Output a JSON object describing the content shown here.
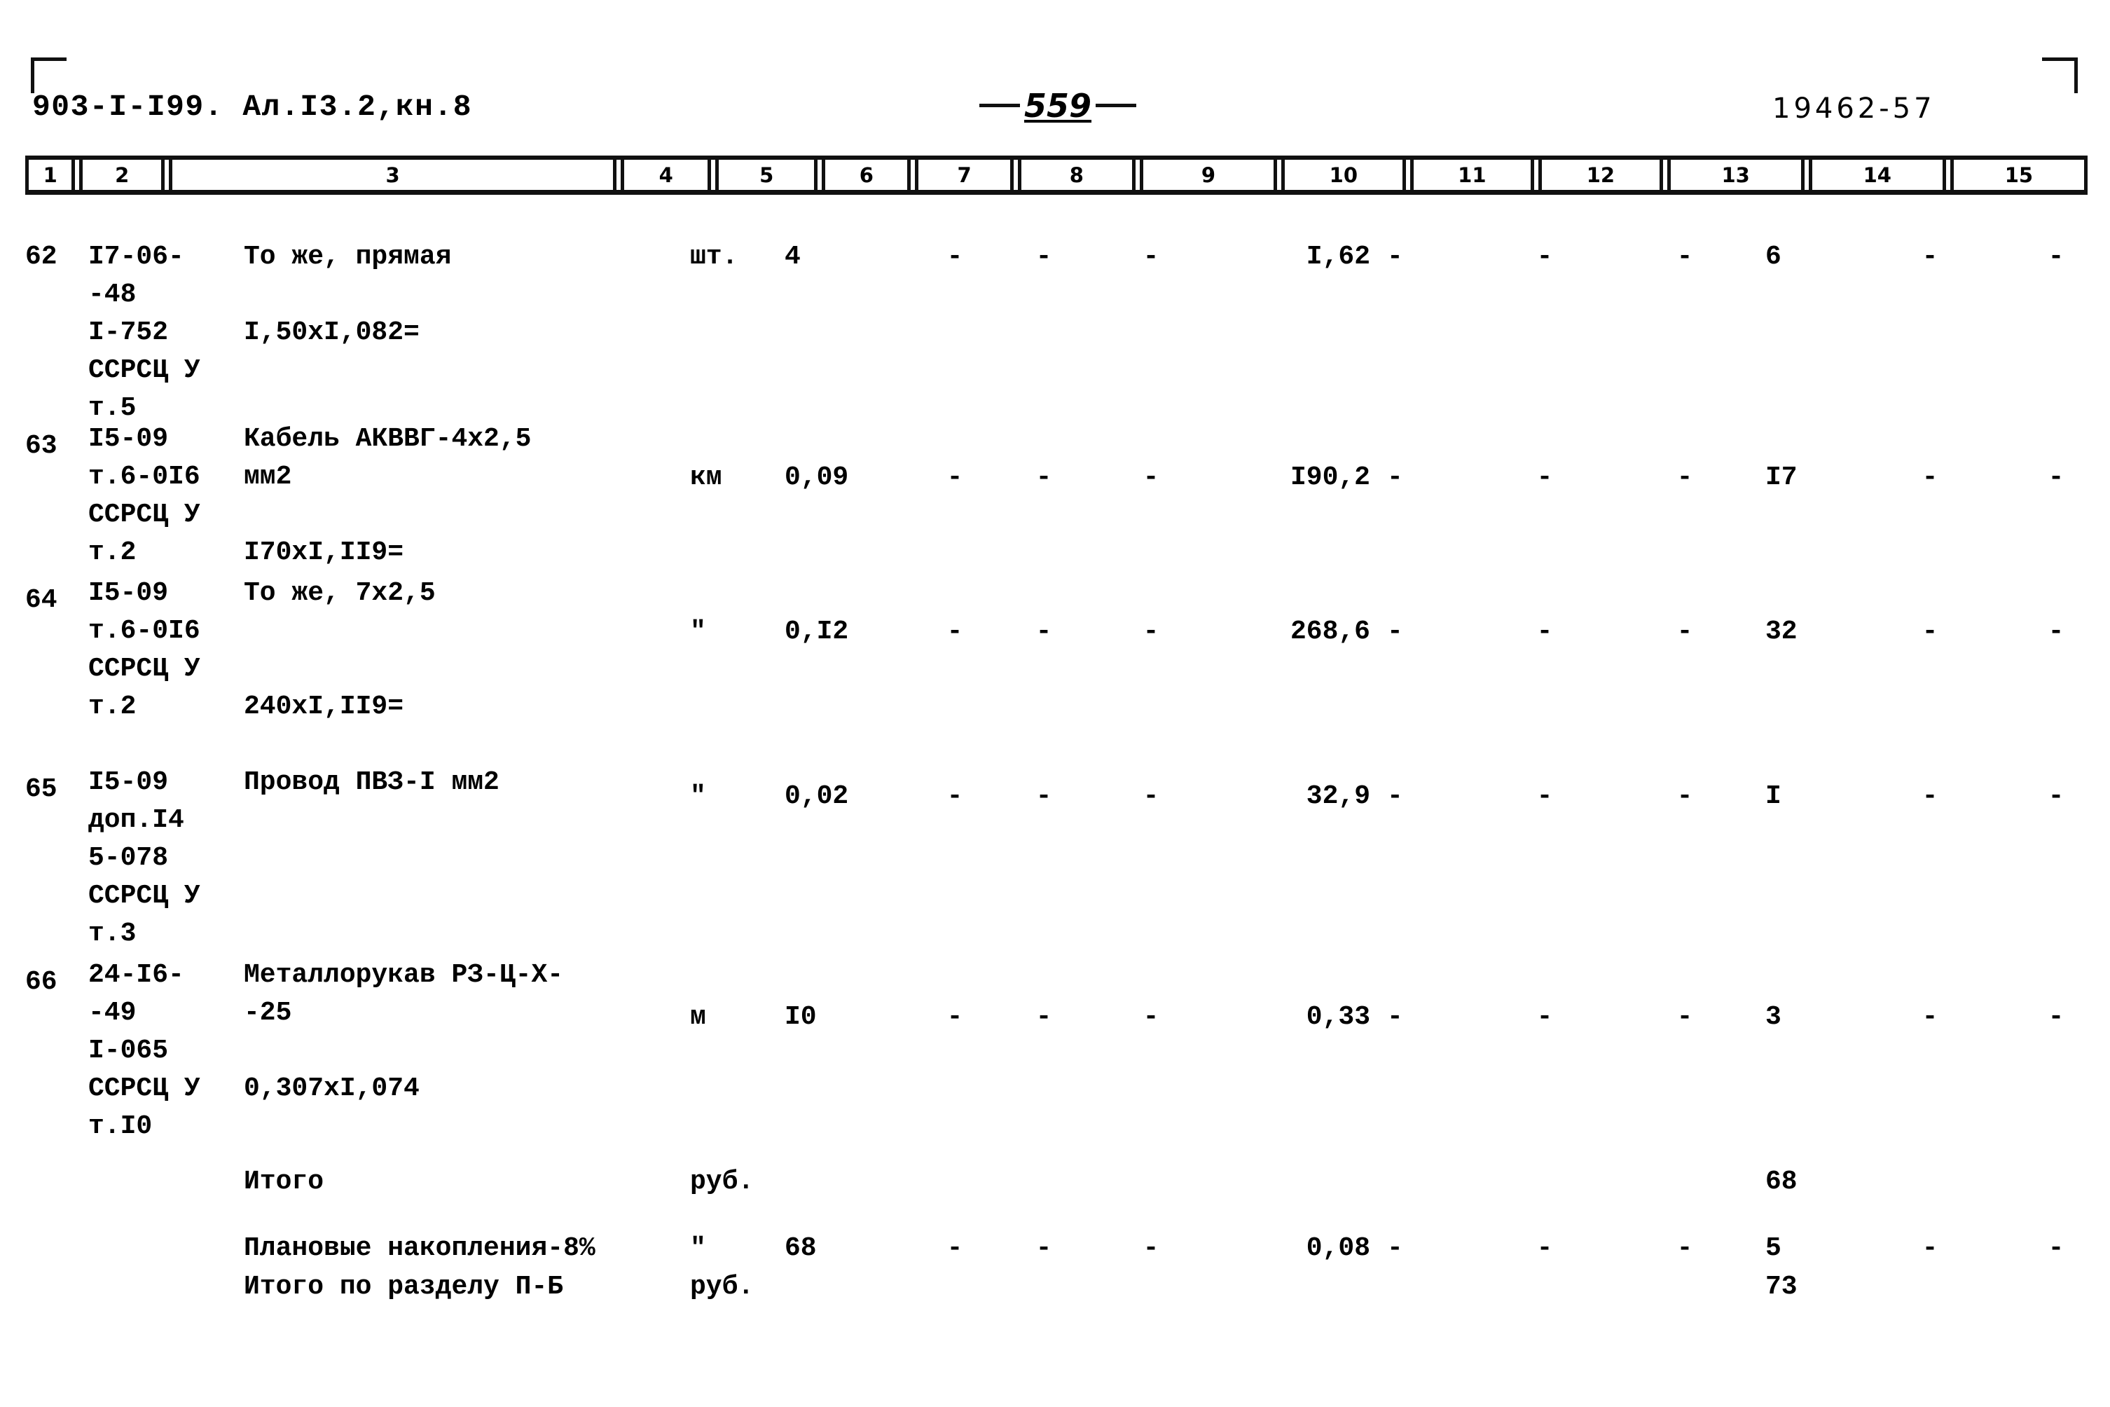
{
  "page": {
    "header_left": "903-I-I99. Ал.I3.2,кн.8",
    "page_number": "559",
    "header_right": "19462-57"
  },
  "table": {
    "column_numbers": [
      "1",
      "2",
      "3",
      "4",
      "5",
      "6",
      "7",
      "8",
      "9",
      "10",
      "11",
      "12",
      "13",
      "14",
      "15"
    ],
    "rows": [
      {
        "num": "62",
        "code": "I7-06-\n -48\nI-752\nССРСЦ У\nт.5",
        "desc": "То же, прямая\n\nI,50xI,082=",
        "unit": "шт.",
        "c5": "4",
        "c6": "-",
        "c7": "-",
        "c8": "-",
        "c9": "I,62",
        "c10": "-",
        "c11": "-",
        "c12": "-",
        "c13": "6",
        "c14": "-",
        "c15": "-"
      },
      {
        "num": "63",
        "code": "I5-09\nт.6-0I6\nССРСЦ У\nт.2",
        "desc": "Кабель АКВВГ-4x2,5\nмм2\n\nI70xI,II9=",
        "unit": "км",
        "c5": "0,09",
        "c6": "-",
        "c7": "-",
        "c8": "-",
        "c9": "I90,2",
        "c10": "-",
        "c11": "-",
        "c12": "-",
        "c13": "I7",
        "c14": "-",
        "c15": "-"
      },
      {
        "num": "64",
        "code": "I5-09\nт.6-0I6\nССРСЦ У\nт.2",
        "desc": "То же, 7x2,5\n\n\n240xI,II9=",
        "unit": "\"",
        "c5": "0,I2",
        "c6": "-",
        "c7": "-",
        "c8": "-",
        "c9": "268,6",
        "c10": "-",
        "c11": "-",
        "c12": "-",
        "c13": "32",
        "c14": "-",
        "c15": "-"
      },
      {
        "num": "65",
        "code": "I5-09\nдоп.I4\n5-078\nССРСЦ У\nт.3",
        "desc": "Провод ПВЗ-I мм2",
        "unit": "\"",
        "c5": "0,02",
        "c6": "-",
        "c7": "-",
        "c8": "-",
        "c9": "32,9",
        "c10": "-",
        "c11": "-",
        "c12": "-",
        "c13": "I",
        "c14": "-",
        "c15": "-"
      },
      {
        "num": "66",
        "code": "24-I6-\n -49\nI-065\nССРСЦ У\nт.I0",
        "desc": "Металлорукав РЗ-Ц-Х-\n -25\n\n0,307xI,074",
        "unit": "м",
        "c5": "I0",
        "c6": "-",
        "c7": "-",
        "c8": "-",
        "c9": "0,33",
        "c10": "-",
        "c11": "-",
        "c12": "-",
        "c13": "3",
        "c14": "-",
        "c15": "-"
      }
    ],
    "totals": [
      {
        "label": "Итого",
        "unit": "руб.",
        "c5": "",
        "c6": "",
        "c7": "",
        "c8": "",
        "c9": "",
        "c10": "",
        "c11": "",
        "c12": "",
        "c13": "68",
        "c14": "",
        "c15": ""
      },
      {
        "label": "Плановые накопления-8%",
        "unit": "\"",
        "c5": "68",
        "c6": "-",
        "c7": "-",
        "c8": "-",
        "c9": "0,08",
        "c10": "-",
        "c11": "-",
        "c12": "-",
        "c13": "5",
        "c14": "-",
        "c15": "-"
      },
      {
        "label": "Итого по разделу П-Б",
        "unit": "руб.",
        "c5": "",
        "c6": "",
        "c7": "",
        "c8": "",
        "c9": "",
        "c10": "",
        "c11": "",
        "c12": "",
        "c13": "73",
        "c14": "",
        "c15": ""
      }
    ]
  }
}
